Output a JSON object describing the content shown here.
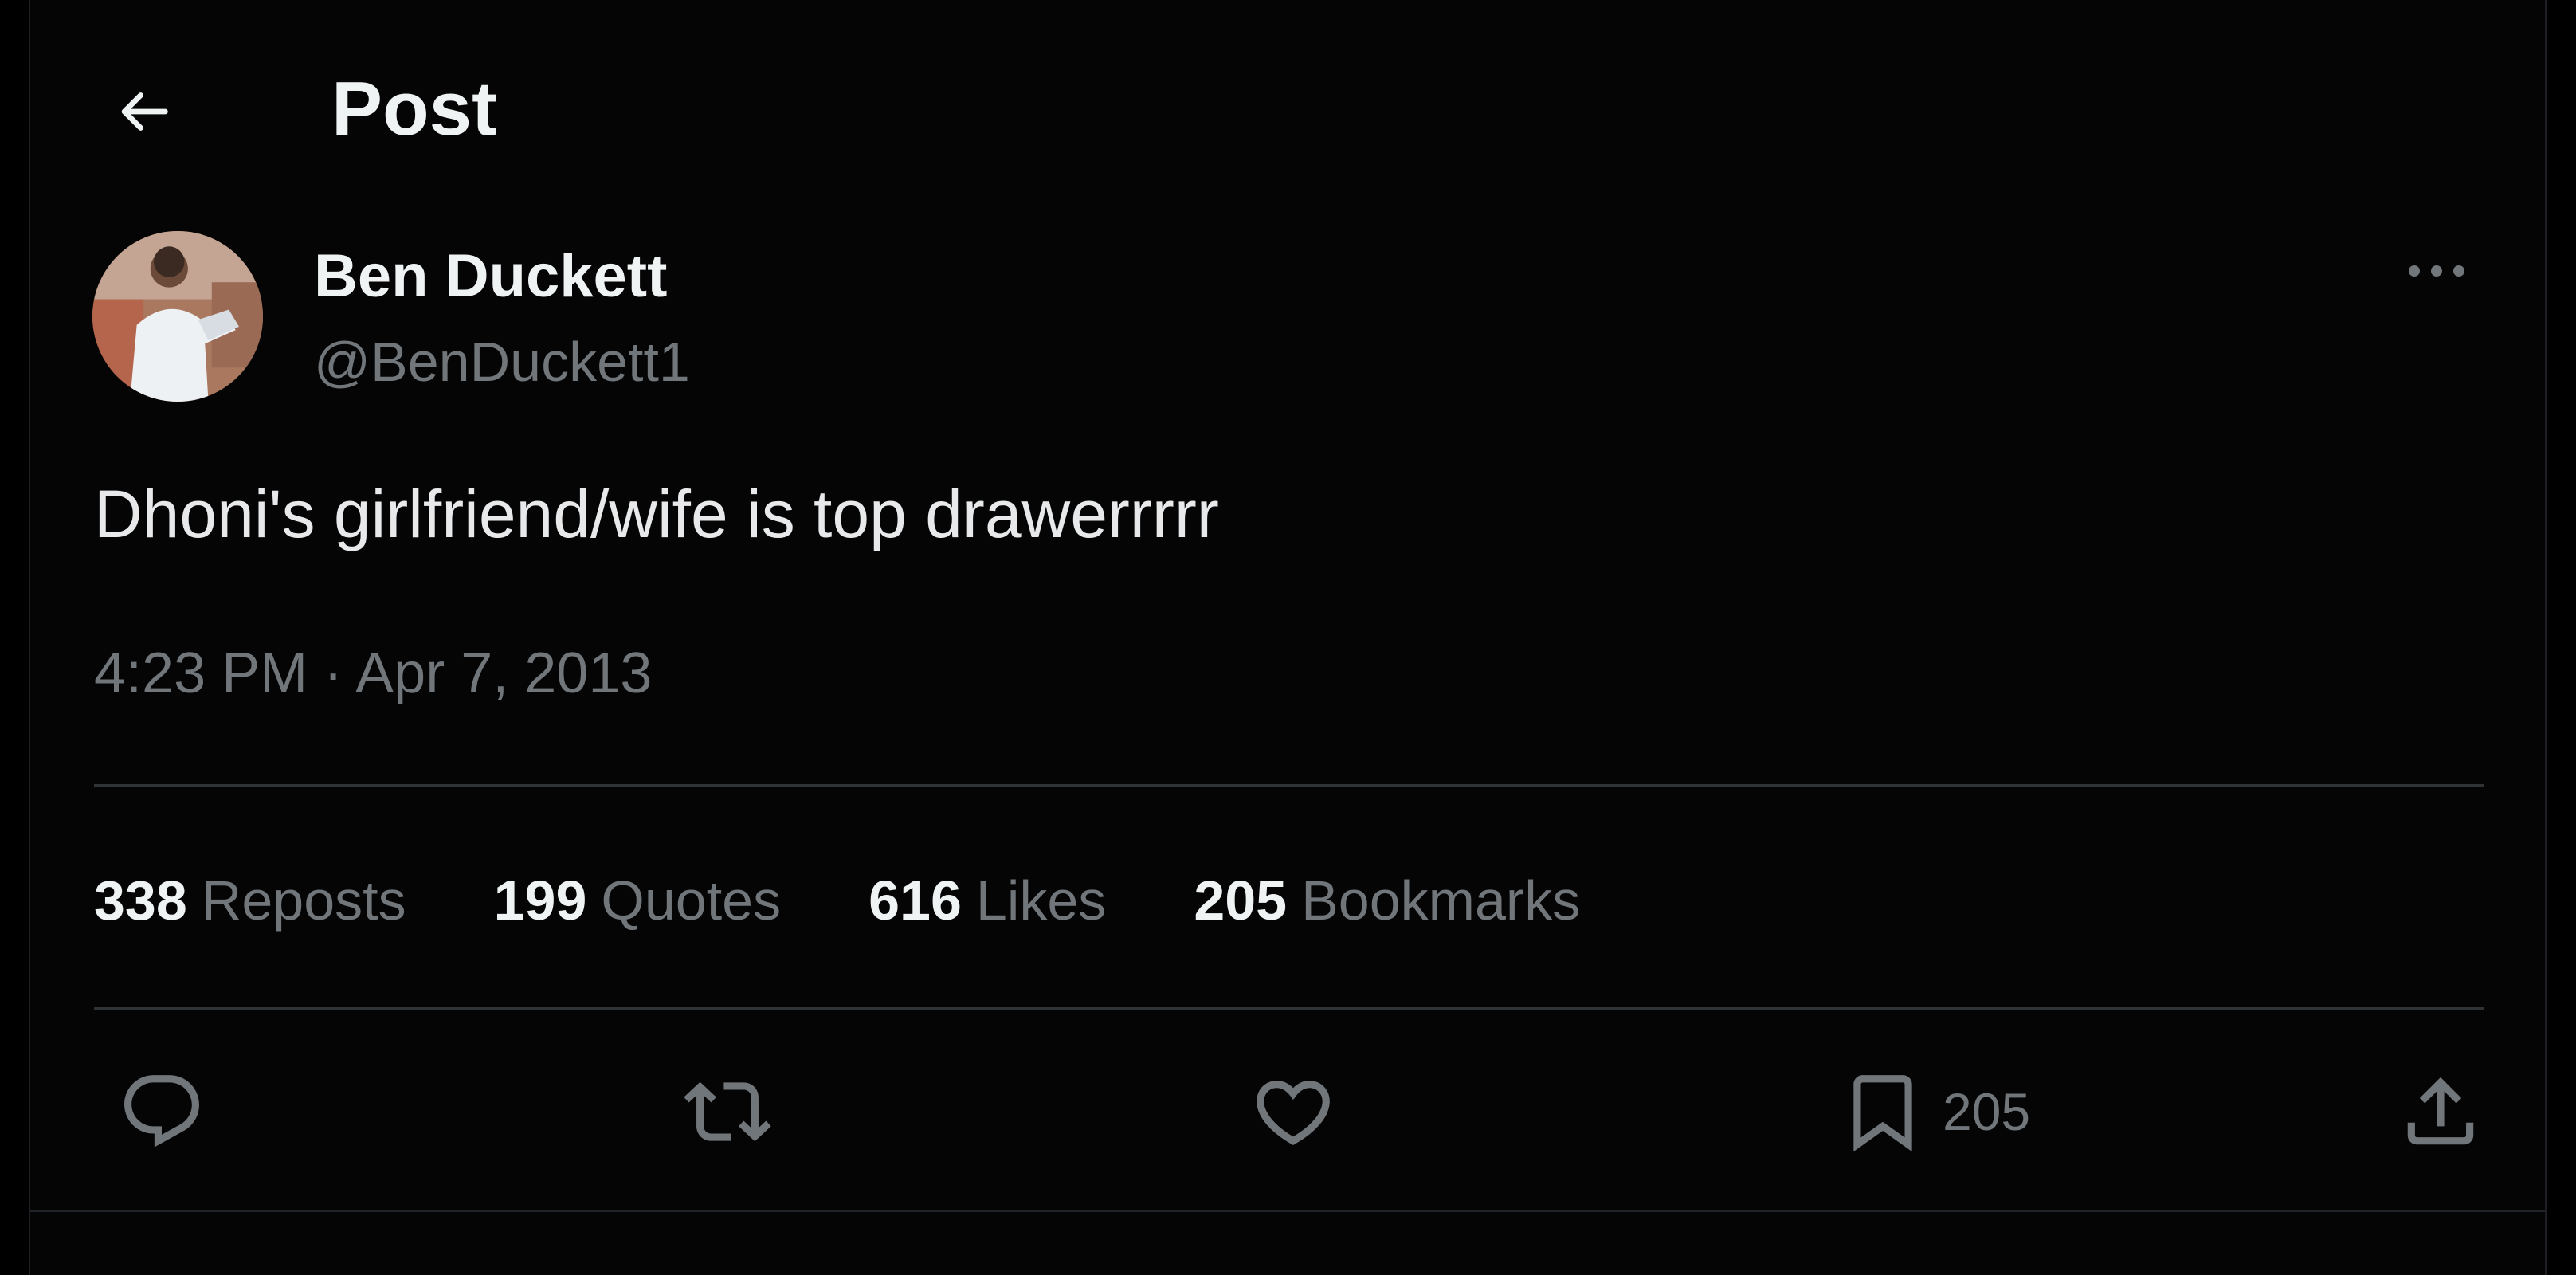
{
  "header": {
    "back_label": "Back",
    "title": "Post"
  },
  "author": {
    "display_name": "Ben Duckett",
    "handle": "@BenDuckett1",
    "avatar_icon": "profile-photo"
  },
  "post": {
    "text": "Dhoni's girlfriend/wife is top drawerrrrr",
    "timestamp": "4:23 PM · Apr 7, 2013"
  },
  "stats": [
    {
      "count": "338",
      "label": "Reposts"
    },
    {
      "count": "199",
      "label": "Quotes"
    },
    {
      "count": "616",
      "label": "Likes"
    },
    {
      "count": "205",
      "label": "Bookmarks"
    }
  ],
  "actions": {
    "reply_icon": "reply-icon",
    "repost_icon": "repost-icon",
    "like_icon": "heart-icon",
    "bookmark_icon": "bookmark-icon",
    "bookmark_count": "205",
    "share_icon": "share-icon"
  },
  "colors": {
    "background": "#000000",
    "primary_text": "#e7e9ea",
    "secondary_text": "#71767b",
    "divider": "#2f3336"
  }
}
